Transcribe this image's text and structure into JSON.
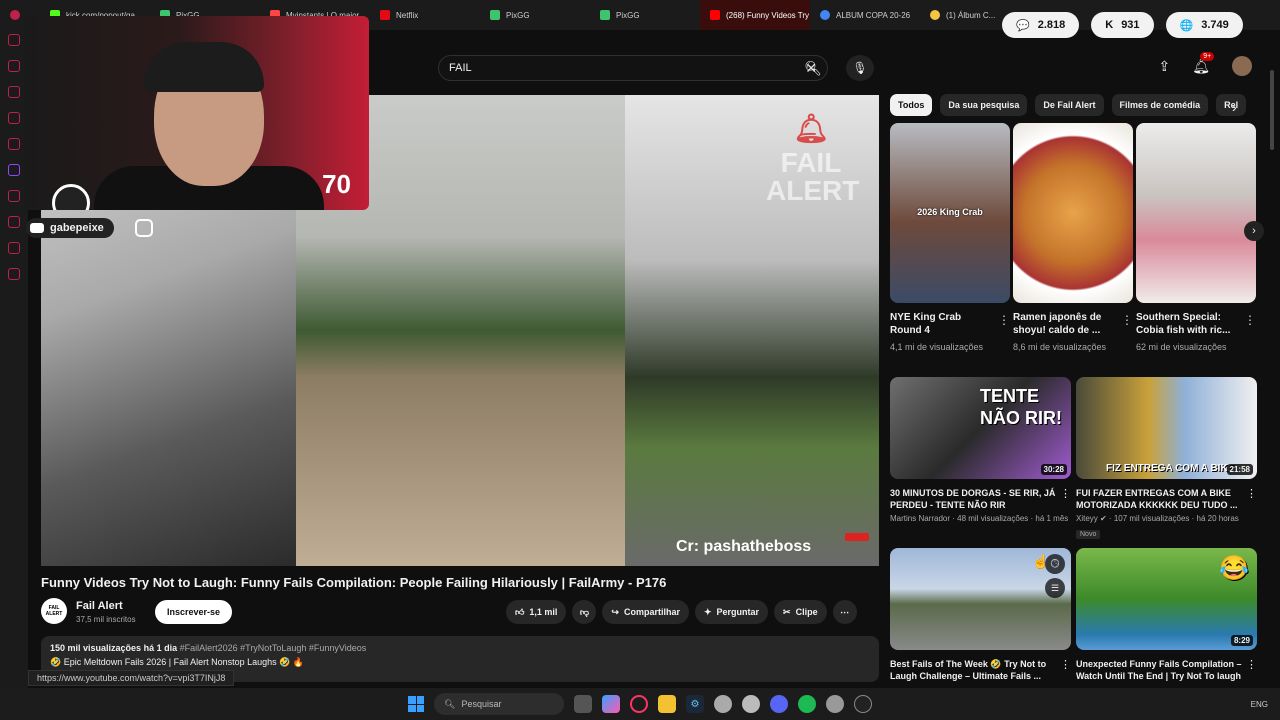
{
  "browser": {
    "tabs": [
      {
        "label": "kick.com/popout/ga...",
        "color": "#53fc18",
        "active": false
      },
      {
        "label": "PixGG",
        "color": "#3ec46d",
        "active": false
      },
      {
        "label": "Myinstants | O maior",
        "color": "#ff4444",
        "active": false
      },
      {
        "label": "Netflix",
        "color": "#e50914",
        "active": false
      },
      {
        "label": "PixGG",
        "color": "#3ec46d",
        "active": false
      },
      {
        "label": "PixGG",
        "color": "#3ec46d",
        "active": false
      },
      {
        "label": "(268) Funny Videos Try N",
        "color": "#ff0000",
        "active": true
      },
      {
        "label": "ALBUM COPA 20-26",
        "color": "#4285f4",
        "active": false
      },
      {
        "label": "(1) Álbum C...",
        "color": "#f4c542",
        "active": false
      }
    ]
  },
  "stats": {
    "comments": "2.818",
    "kick": "931",
    "viewers": "3.749"
  },
  "search": {
    "query": "FAIL"
  },
  "header": {
    "notifications": "9+"
  },
  "stream_overlay": {
    "counter": "70",
    "handle": "gabepeixe"
  },
  "player": {
    "credit": "Cr: pashatheboss",
    "brand_line1": "FAIL",
    "brand_line2": "ALERT"
  },
  "video": {
    "title": "Funny Videos Try Not to Laugh: Funny Fails Compilation: People Failing Hilariously | FailArmy - P176",
    "channel": "Fail Alert",
    "channel_avatar_text": "FAIL ALERT",
    "subscribers": "37,5 mil inscritos",
    "subscribe_label": "Inscrever-se",
    "likes": "1,1 mil",
    "share_label": "Compartilhar",
    "ask_label": "Perguntar",
    "clip_label": "Clipe",
    "views": "150 mil visualizações",
    "age": "há 1 dia",
    "hashtags": "#FailAlert2026 #TryNotToLaugh #FunnyVideos",
    "description_line": "🤣 Epic Meltdown Fails 2026 | Fail Alert Nonstop Laughs 🤣 🔥"
  },
  "status_url": "https://www.youtube.com/watch?v=vpi3T7INjJ8",
  "chips": [
    {
      "label": "Todos",
      "active": true
    },
    {
      "label": "Da sua pesquisa",
      "active": false
    },
    {
      "label": "De Fail Alert",
      "active": false
    },
    {
      "label": "Filmes de comédia",
      "active": false
    },
    {
      "label": "Rel",
      "active": false
    }
  ],
  "shorts": [
    {
      "title": "NYE King Crab Round 4",
      "views": "4,1 mi de visualizações",
      "caption": "2026 King Crab",
      "color": "#8a8f97"
    },
    {
      "title": "Ramen japonês de shoyu! caldo de ...",
      "views": "8,6 mi de visualizações",
      "caption": "",
      "color": "#c4742a"
    },
    {
      "title": "Southern Special: Cobia fish with ric...",
      "views": "62 mi de visualizações",
      "caption": "",
      "color": "#d9d4cf"
    }
  ],
  "recommendations": [
    {
      "title": "30 MINUTOS DE DORGAS - SE RIR, JÁ PERDEU - TENTE NÃO RIR IMPOSSÍV...",
      "meta": "Martins Narrador · 48 mil visualizações · há 1 mês",
      "duration": "30:28",
      "overlay": "TENTE NÃO RIR!",
      "badge": ""
    },
    {
      "title": "FUI FAZER ENTREGAS COM A BIKE MOTORIZADA KKKKKK DEU TUDO ...",
      "meta": "Xiteyy ✔ · 107 mil visualizações · há 20 horas",
      "duration": "21:58",
      "overlay": "FIZ ENTREGA COM A BIKE",
      "badge": "Novo"
    },
    {
      "title": "Best Fails of The Week 🤣 Try Not to Laugh Challenge – Ultimate Fails ...",
      "meta": "",
      "duration": "",
      "overlay": "",
      "badge": ""
    },
    {
      "title": "Unexpected Funny Fails Compilation – Watch Until The End | Try Not To laugh",
      "meta": "",
      "duration": "8:29",
      "overlay": "😂",
      "badge": ""
    }
  ],
  "taskbar": {
    "search_placeholder": "Pesquisar",
    "lang": "ENG"
  }
}
